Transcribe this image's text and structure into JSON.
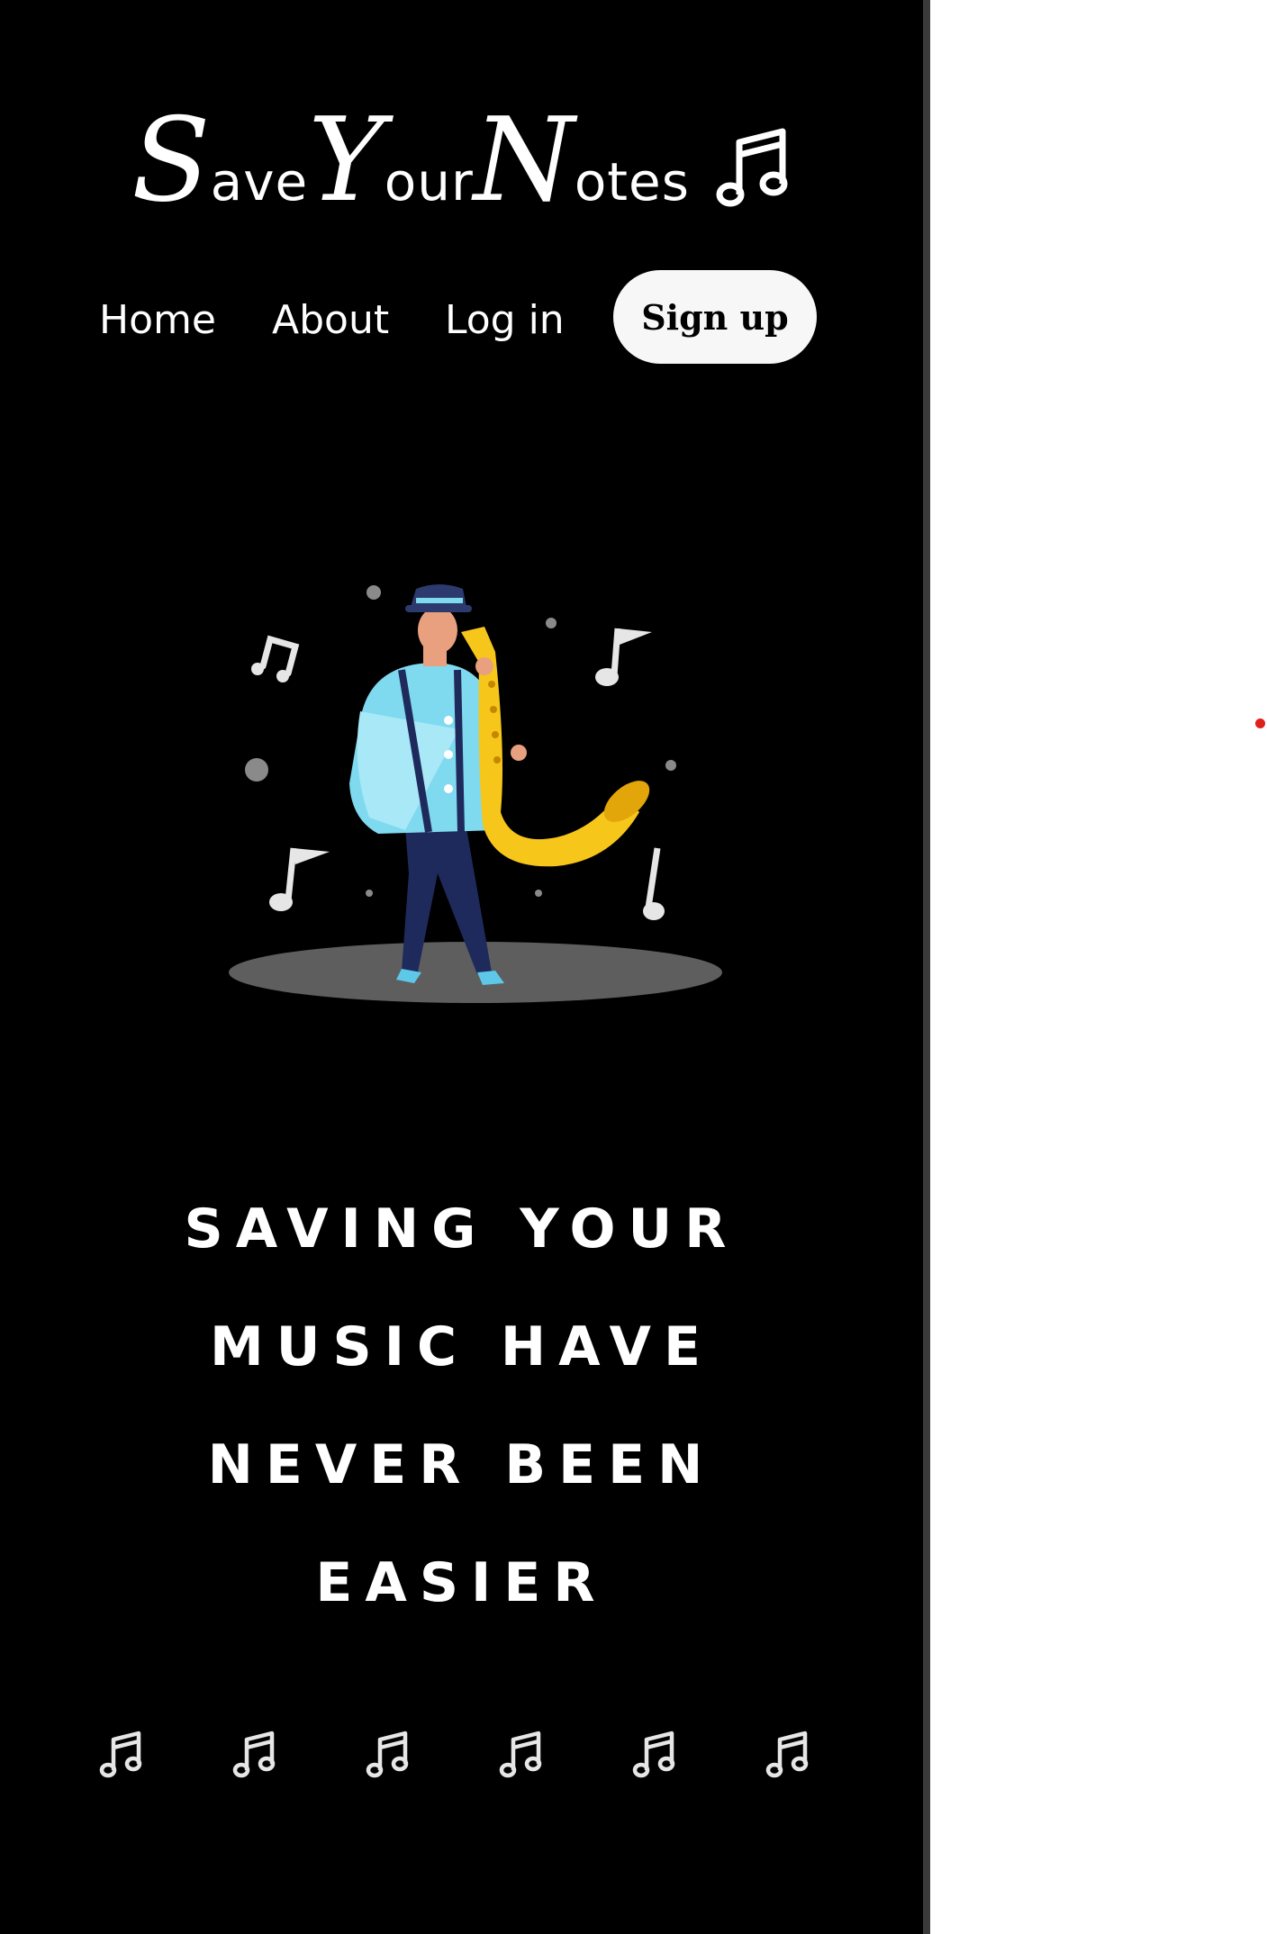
{
  "brand": {
    "logo_parts": [
      "S",
      "ave",
      "Y",
      "our",
      "N",
      "otes"
    ],
    "logo_icon": "music-notes-icon"
  },
  "nav": {
    "home": "Home",
    "about": "About",
    "login": "Log in",
    "signup": "Sign up"
  },
  "hero": {
    "illustration": "saxophone-player-illustration",
    "headline_lines": [
      "SAVING YOUR",
      "MUSIC HAVE",
      "NEVER BEEN",
      "EASIER"
    ]
  },
  "decor": {
    "note_row_icon": "music-notes-icon",
    "note_row_count": 6
  },
  "colors": {
    "panel_bg": "#000000",
    "text": "#ffffff",
    "button_bg": "#f7f7f7",
    "sax_gold": "#f6c61b",
    "shirt_blue": "#7fd9ef",
    "pants_navy": "#1f2a5c",
    "stage_gray": "#5e5e5e",
    "marker_red": "#e0201b"
  }
}
